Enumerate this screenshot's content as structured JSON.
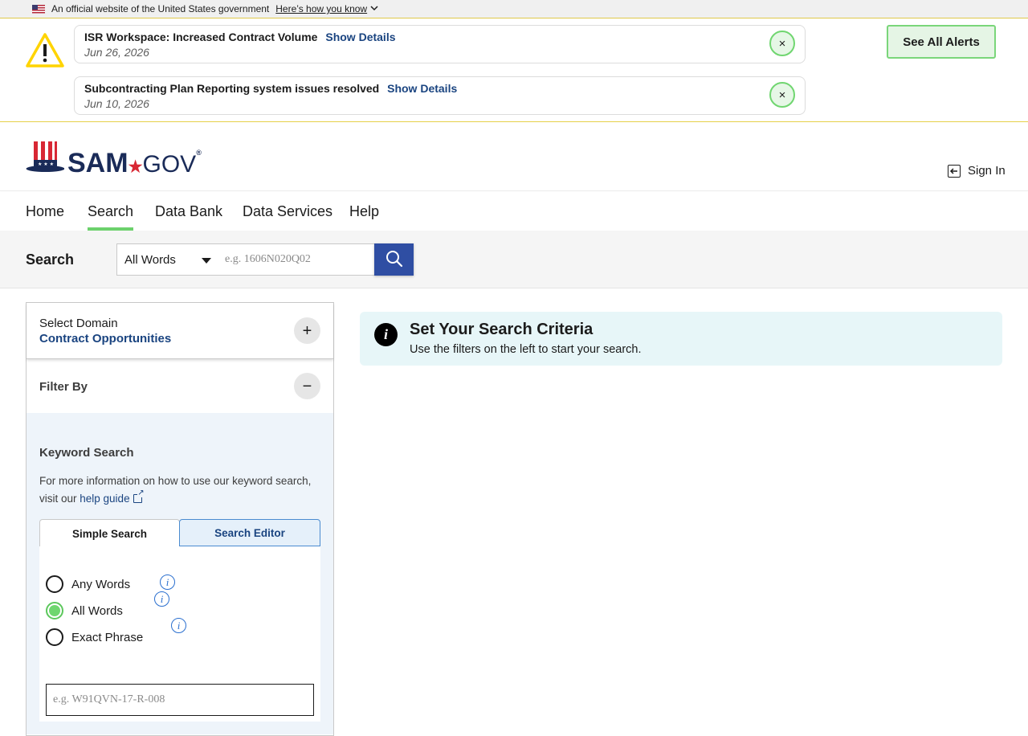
{
  "gov_banner": {
    "text": "An official website of the United States government",
    "link": "Here’s how you know"
  },
  "alerts": [
    {
      "title": "ISR Workspace: Increased Contract Volume",
      "link": "Show Details",
      "date": "Jun 26, 2026",
      "close": "×"
    },
    {
      "title": "Subcontracting Plan Reporting system issues resolved",
      "link": "Show Details",
      "date": "Jun 10, 2026",
      "close": "×"
    }
  ],
  "see_all_alerts": "See All Alerts",
  "logo": {
    "name": "SAM",
    "dot": "★",
    "tld": "GOV",
    "reg": "®"
  },
  "signin": {
    "label": "Sign In",
    "icon": "sign-in-icon"
  },
  "nav": {
    "items": [
      "Home",
      "Search",
      "Data Bank",
      "Data Services",
      "Help"
    ],
    "active": "Search"
  },
  "search": {
    "label": "Search",
    "mode": "All Words",
    "placeholder": "e.g. 1606N020Q02",
    "button_icon": "search-icon"
  },
  "sidebar": {
    "domain_label": "Select Domain",
    "domain_value": "Contract Opportunities",
    "domain_toggle": "+",
    "filter_label": "Filter By",
    "filter_toggle": "−",
    "keyword": {
      "title": "Keyword Search",
      "desc_prefix": "For more information on how to use our keyword search, visit our ",
      "help_link": "help guide",
      "tabs": [
        "Simple Search",
        "Search Editor"
      ],
      "options": [
        {
          "label": "Any Words",
          "checked": false
        },
        {
          "label": "All Words",
          "checked": true
        },
        {
          "label": "Exact Phrase",
          "checked": false
        }
      ],
      "info_glyph": "i",
      "input_placeholder": "e.g. W91QVN-17-R-008"
    }
  },
  "info_box": {
    "icon": "i",
    "title": "Set Your Search Criteria",
    "text": "Use the filters on the left to start your search."
  },
  "colors": {
    "accent_green": "#6cd16c",
    "brand_navy": "#1a2b58",
    "link_blue": "#1a4480",
    "search_button": "#2f4ea3",
    "alert_yellow": "#ffd400",
    "info_bg": "#e7f6f8"
  }
}
